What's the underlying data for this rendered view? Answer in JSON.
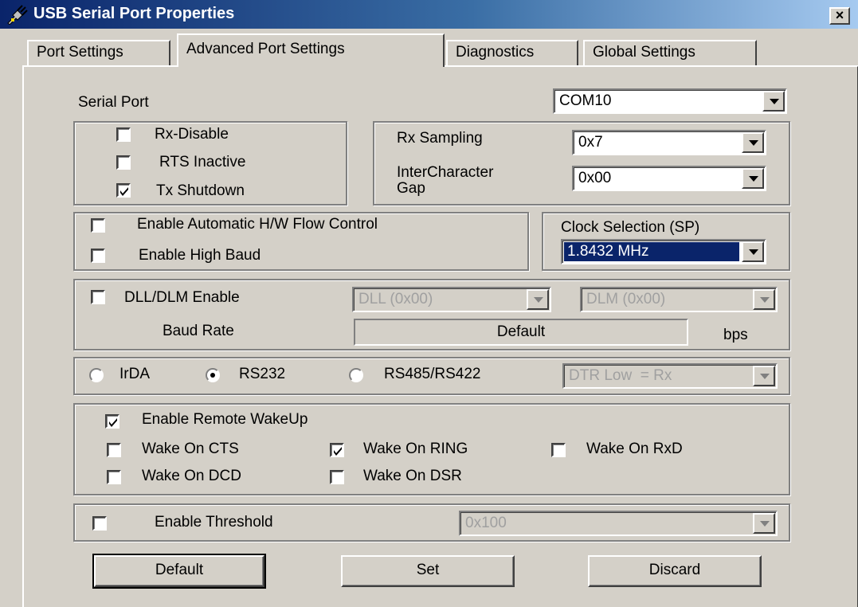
{
  "window": {
    "title": "USB Serial Port Properties",
    "close_label": "×"
  },
  "tabs": [
    {
      "label": "Port Settings"
    },
    {
      "label": "Advanced Port Settings"
    },
    {
      "label": "Diagnostics"
    },
    {
      "label": "Global Settings"
    }
  ],
  "serial_port": {
    "label": "Serial Port",
    "value": "COM10"
  },
  "rx_options": {
    "rx_disable": {
      "label": "Rx-Disable",
      "checked": false
    },
    "rts_inactive": {
      "label": "RTS Inactive",
      "checked": false
    },
    "tx_shutdown": {
      "label": "Tx Shutdown",
      "checked": true
    }
  },
  "rx_sampling": {
    "label": "Rx Sampling",
    "value": "0x7"
  },
  "inter_char_gap": {
    "label_line1": "InterCharacter",
    "label_line2": "Gap",
    "value": "0x00"
  },
  "flow": {
    "auto_hw_flow": {
      "label": "Enable Automatic H/W Flow Control",
      "checked": false
    },
    "high_baud": {
      "label": "Enable High Baud",
      "checked": false
    }
  },
  "clock": {
    "label": "Clock Selection (SP)",
    "value": "1.8432 MHz",
    "highlight": "#0a246a"
  },
  "dll_dlm": {
    "enable_label": "DLL/DLM Enable",
    "checked": false,
    "dll_value": "DLL (0x00)",
    "dlm_value": "DLM (0x00)",
    "baud_label": "Baud Rate",
    "baud_value": "Default",
    "unit": "bps"
  },
  "mode": {
    "irda": "IrDA",
    "rs232": "RS232",
    "rs485": "RS485/RS422",
    "selected": "RS232",
    "dtr_value": "DTR Low  = Rx"
  },
  "wakeup": {
    "enable": {
      "label": "Enable Remote WakeUp",
      "checked": true
    },
    "cts": {
      "label": "Wake On CTS",
      "checked": false
    },
    "ring": {
      "label": "Wake On RING",
      "checked": true
    },
    "rxd": {
      "label": "Wake On RxD",
      "checked": false
    },
    "dcd": {
      "label": "Wake On DCD",
      "checked": false
    },
    "dsr": {
      "label": "Wake On DSR",
      "checked": false
    }
  },
  "threshold": {
    "label": "Enable Threshold",
    "checked": false,
    "value": "0x100"
  },
  "buttons": {
    "default": "Default",
    "set": "Set",
    "discard": "Discard"
  }
}
